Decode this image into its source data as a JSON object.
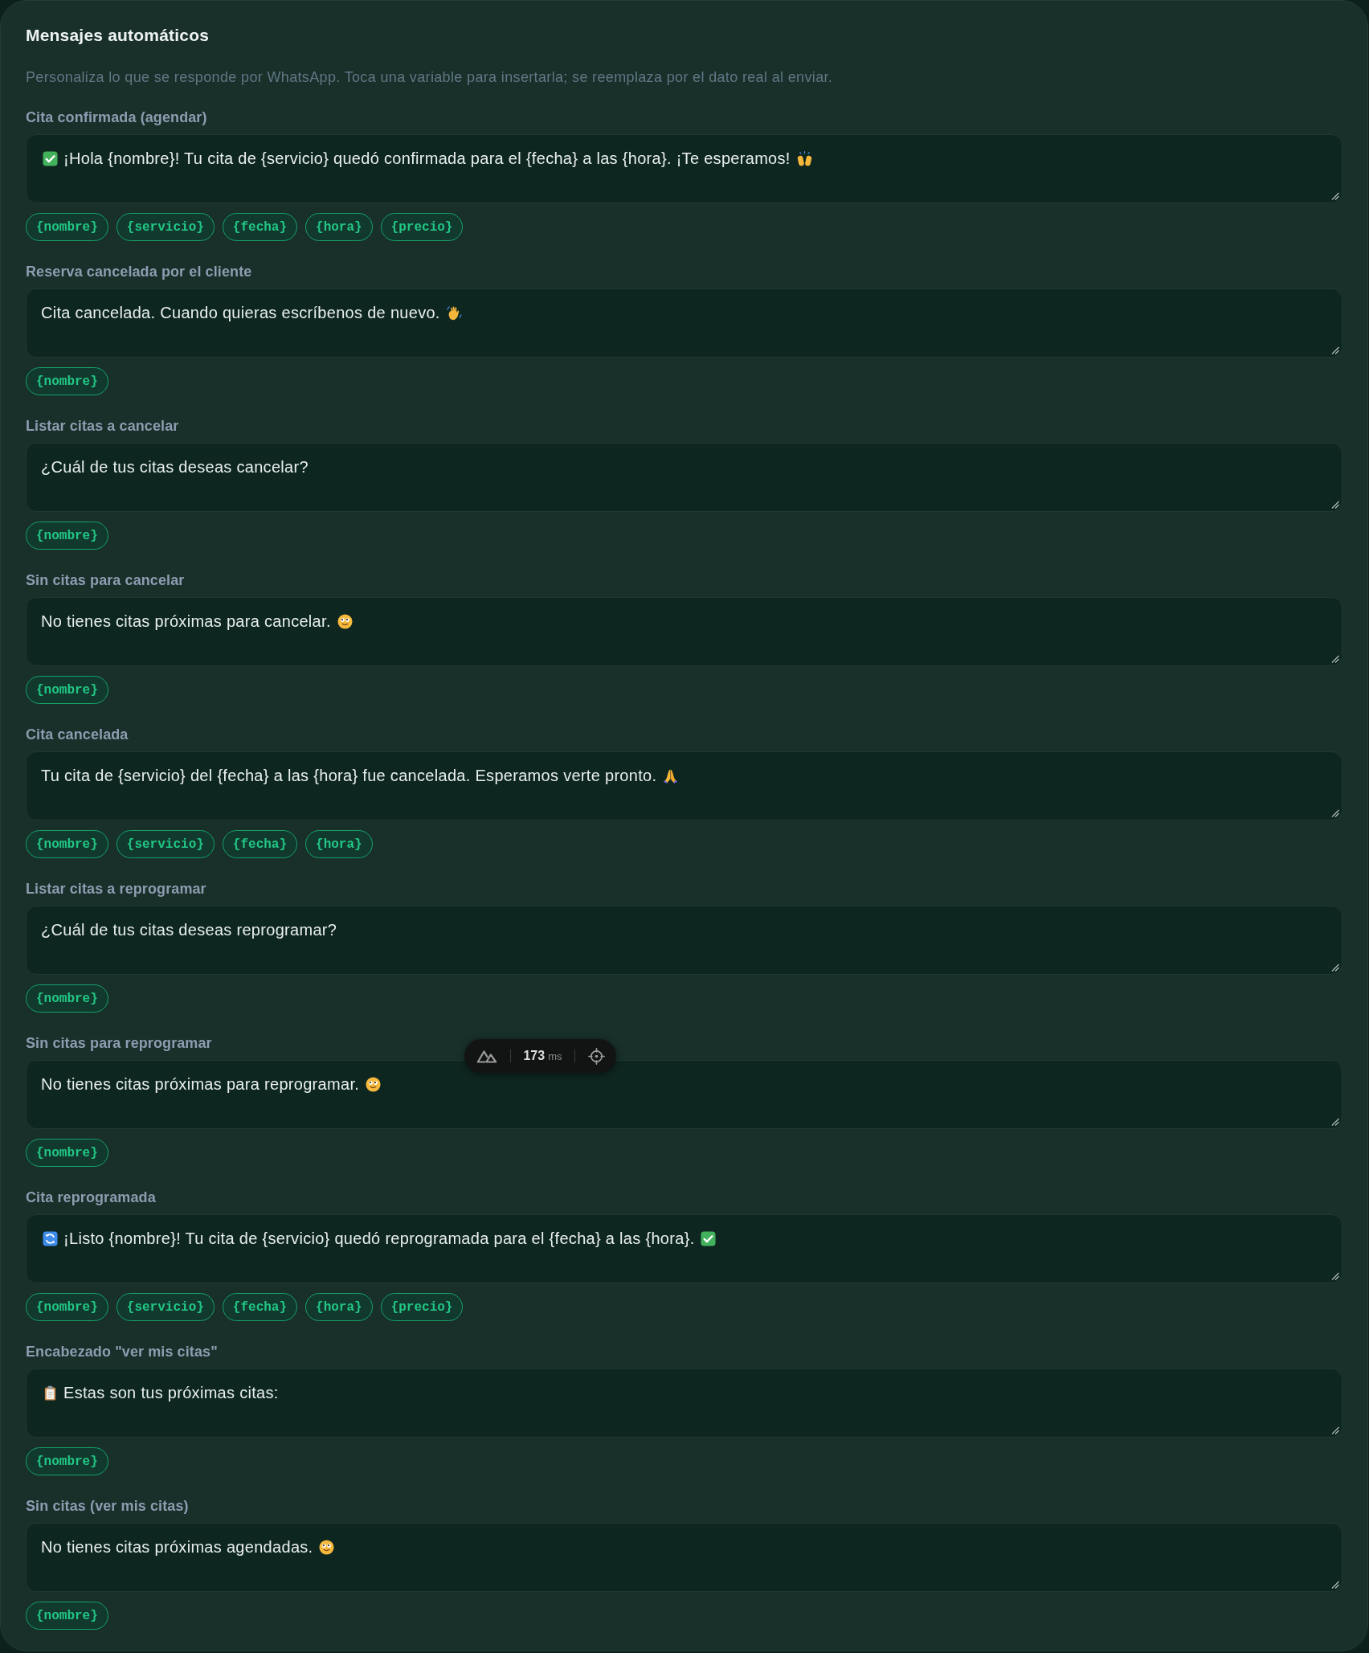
{
  "panel": {
    "title": "Mensajes automáticos",
    "description": "Personaliza lo que se responde por WhatsApp. Toca una variable para insertarla; se reemplaza por el dato real al enviar."
  },
  "templates": [
    {
      "label": "Cita confirmada (agendar)",
      "message": [
        {
          "kind": "check"
        },
        {
          "kind": "text",
          "text": "¡Hola {nombre}! Tu cita de {servicio} quedó confirmada para el {fecha} a las {hora}. ¡Te esperamos!"
        },
        {
          "kind": "hands"
        }
      ],
      "variables": [
        "{nombre}",
        "{servicio}",
        "{fecha}",
        "{hora}",
        "{precio}"
      ]
    },
    {
      "label": "Reserva cancelada por el cliente",
      "message": [
        {
          "kind": "text",
          "text": "Cita cancelada. Cuando quieras escríbenos de nuevo."
        },
        {
          "kind": "wave"
        }
      ],
      "variables": [
        "{nombre}"
      ]
    },
    {
      "label": "Listar citas a cancelar",
      "message": [
        {
          "kind": "text",
          "text": "¿Cuál de tus citas deseas cancelar?"
        }
      ],
      "variables": [
        "{nombre}"
      ]
    },
    {
      "label": "Sin citas para cancelar",
      "message": [
        {
          "kind": "text",
          "text": "No tienes citas próximas para cancelar."
        },
        {
          "kind": "smile"
        }
      ],
      "variables": [
        "{nombre}"
      ]
    },
    {
      "label": "Cita cancelada",
      "message": [
        {
          "kind": "text",
          "text": "Tu cita de {servicio} del {fecha} a las {hora} fue cancelada. Esperamos verte pronto."
        },
        {
          "kind": "pray"
        }
      ],
      "variables": [
        "{nombre}",
        "{servicio}",
        "{fecha}",
        "{hora}"
      ]
    },
    {
      "label": "Listar citas a reprogramar",
      "message": [
        {
          "kind": "text",
          "text": "¿Cuál de tus citas deseas reprogramar?"
        }
      ],
      "variables": [
        "{nombre}"
      ]
    },
    {
      "label": "Sin citas para reprogramar",
      "message": [
        {
          "kind": "text",
          "text": "No tienes citas próximas para reprogramar."
        },
        {
          "kind": "smile"
        }
      ],
      "variables": [
        "{nombre}"
      ]
    },
    {
      "label": "Cita reprogramada",
      "message": [
        {
          "kind": "refresh"
        },
        {
          "kind": "text",
          "text": "¡Listo {nombre}! Tu cita de {servicio} quedó reprogramada para el {fecha} a las {hora}."
        },
        {
          "kind": "check"
        }
      ],
      "variables": [
        "{nombre}",
        "{servicio}",
        "{fecha}",
        "{hora}",
        "{precio}"
      ]
    },
    {
      "label": "Encabezado \"ver mis citas\"",
      "message": [
        {
          "kind": "clipboard"
        },
        {
          "kind": "text",
          "text": "Estas son tus próximas citas:"
        }
      ],
      "variables": [
        "{nombre}"
      ]
    },
    {
      "label": "Sin citas (ver mis citas)",
      "message": [
        {
          "kind": "text",
          "text": "No tienes citas próximas agendadas."
        },
        {
          "kind": "smile"
        }
      ],
      "variables": [
        "{nombre}"
      ]
    }
  ],
  "devtools_bar": {
    "time": "173",
    "unit": "ms"
  }
}
